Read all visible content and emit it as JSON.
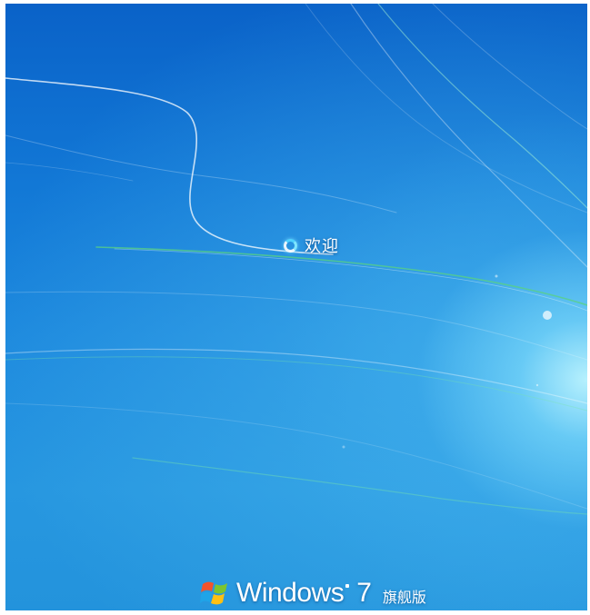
{
  "screen": {
    "status_text": "欢迎",
    "status_icon": "loading-spinner-icon"
  },
  "brand": {
    "logo_icon": "windows-flag-icon",
    "name": "Windows",
    "version": "7",
    "edition": "旗舰版"
  },
  "colors": {
    "background_dark": "#0a62c8",
    "background_mid": "#1e8ade",
    "glow": "#bef5ff",
    "text": "#ffffff"
  }
}
